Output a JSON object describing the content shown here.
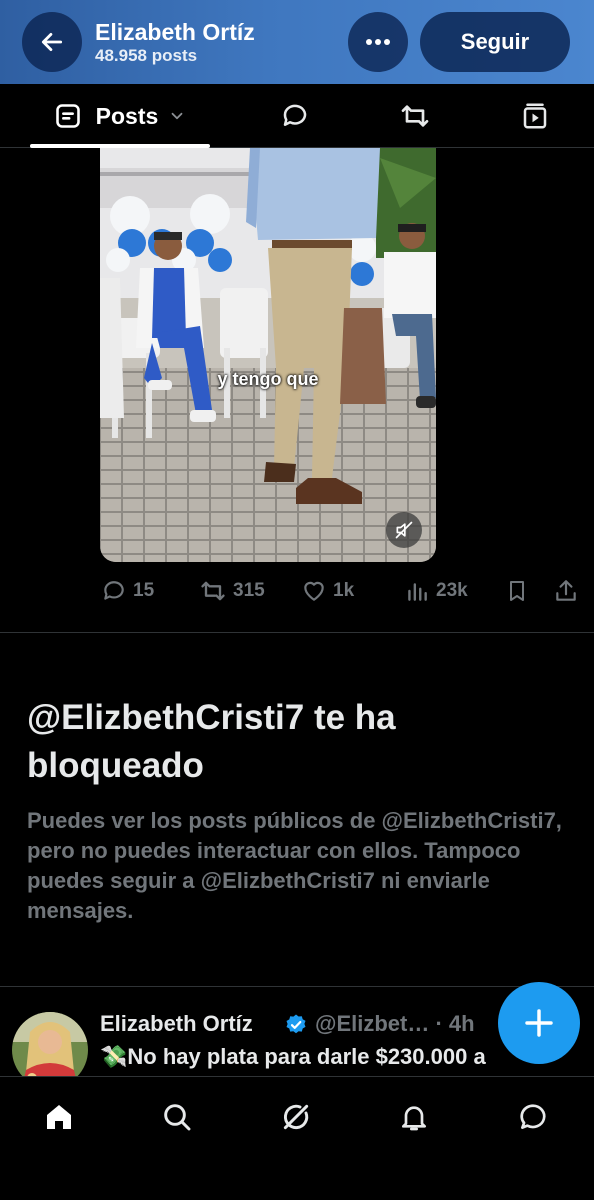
{
  "header": {
    "name": "Elizabeth Ortíz",
    "post_count": "48.958 posts",
    "follow_label": "Seguir",
    "icons": {
      "back": "arrow-left-icon",
      "more": "more-dots-icon"
    }
  },
  "tabs": [
    {
      "label": "Posts",
      "icon": "posts-icon",
      "selected": true
    },
    {
      "label": "",
      "icon": "reply-bubble-icon"
    },
    {
      "label": "",
      "icon": "repost-icon"
    },
    {
      "label": "",
      "icon": "video-tab-icon"
    }
  ],
  "video": {
    "caption": "y tengo que",
    "muted": true
  },
  "actions": {
    "replies": "15",
    "reposts": "315",
    "likes": "1k",
    "views": "23k"
  },
  "blocked": {
    "title": "@ElizbethCristi7 te ha bloqueado",
    "body": "Puedes ver los posts públicos de @ElizbethCristi7, pero no puedes interactuar con ellos. Tampoco puedes seguir a @ElizbethCristi7 ni enviarle mensajes."
  },
  "next_post": {
    "name": "Elizabeth Ortíz",
    "handle_time": "@Elizbet… · 4h",
    "text": "💸No hay plata para darle $230.000 a"
  },
  "colors": {
    "accent": "#1d9bf0",
    "header_gradient_start": "#2f5fa2",
    "header_gradient_end": "#4b86cf",
    "muted_text": "#71767b"
  },
  "bottom_nav": [
    "home-icon",
    "search-icon",
    "grok-icon",
    "notifications-bell-icon",
    "messages-icon"
  ]
}
